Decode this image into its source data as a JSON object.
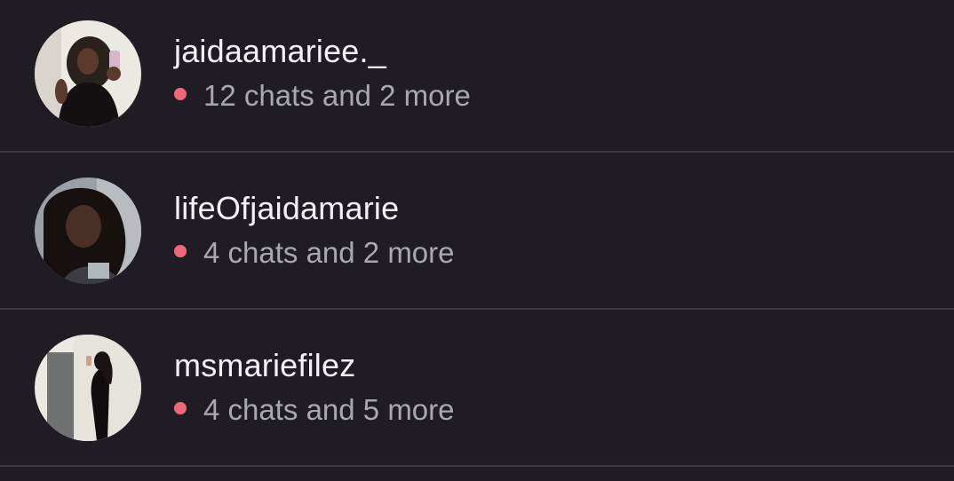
{
  "theme": {
    "background": "#1f1d23",
    "divider": "#3a3840",
    "username_color": "#f4f2f6",
    "activity_color": "#a9a7b0",
    "notification_dot": "#f0677a"
  },
  "accounts": [
    {
      "username": "jaidaamariee._",
      "activity": "12 chats and 2 more",
      "avatar_icon": "profile-photo"
    },
    {
      "username": "lifeOfjaidamarie",
      "activity": "4 chats and 2 more",
      "avatar_icon": "profile-photo"
    },
    {
      "username": "msmariefilez",
      "activity": "4 chats and 5 more",
      "avatar_icon": "profile-photo"
    }
  ]
}
